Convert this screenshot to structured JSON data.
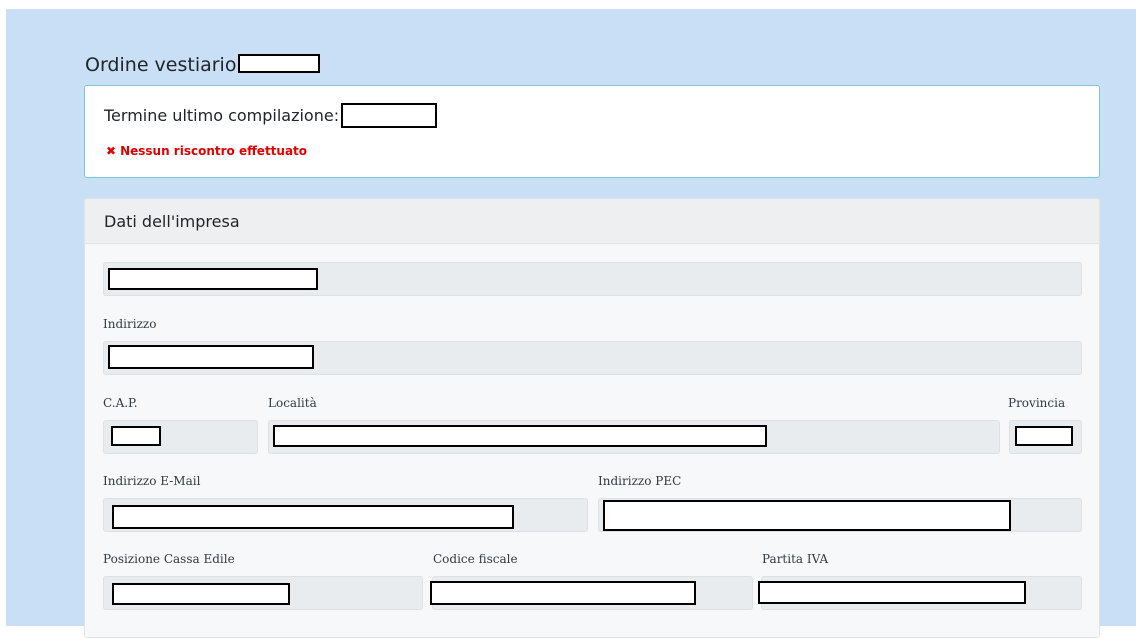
{
  "page": {
    "title": "Ordine vestiario"
  },
  "deadline": {
    "label": "Termine ultimo compilazione:"
  },
  "status": {
    "icon": "x-icon",
    "text": "Nessun riscontro effettuato",
    "color": "#e30000"
  },
  "company_card": {
    "title": "Dati dell'impresa",
    "fields": {
      "indirizzo": {
        "label": "Indirizzo"
      },
      "cap": {
        "label": "C.A.P."
      },
      "localita": {
        "label": "Località"
      },
      "provincia": {
        "label": "Provincia"
      },
      "email": {
        "label": "Indirizzo E-Mail"
      },
      "pec": {
        "label": "Indirizzo PEC"
      },
      "cassa_edile": {
        "label": "Posizione Cassa Edile"
      },
      "codice_fiscale": {
        "label": "Codice fiscale"
      },
      "partita_iva": {
        "label": "Partita IVA"
      }
    }
  },
  "colors": {
    "page_background": "#c9dff5",
    "info_border": "#7fc6d2",
    "field_background": "#e9ecef"
  }
}
